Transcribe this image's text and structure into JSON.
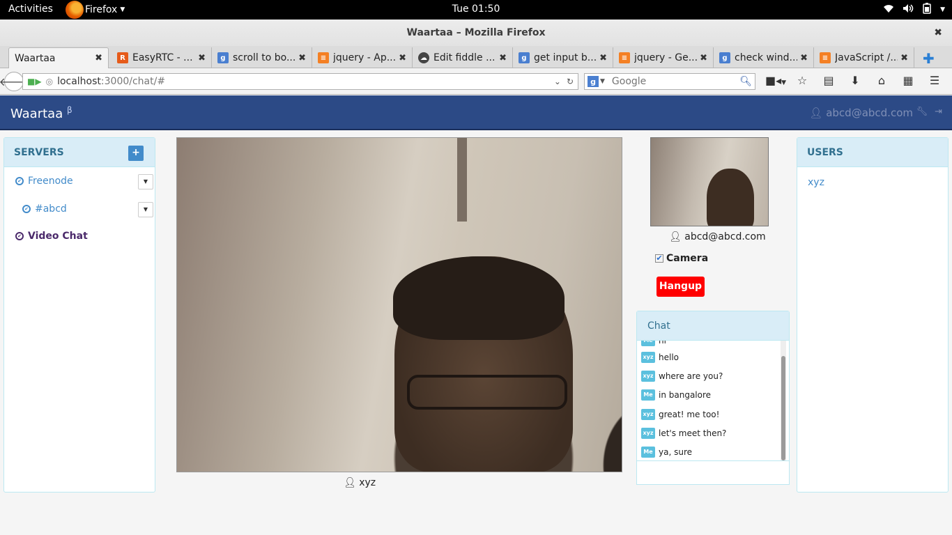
{
  "gnome": {
    "activities": "Activities",
    "app_name": "Firefox",
    "clock": "Tue 01:50"
  },
  "window": {
    "title": "Waartaa – Mozilla Firefox"
  },
  "tabs": [
    {
      "label": "Waartaa",
      "favicon": "none"
    },
    {
      "label": "EasyRTC - ...",
      "favicon": "easyrtc-icon"
    },
    {
      "label": "scroll to bo...",
      "favicon": "google-icon"
    },
    {
      "label": "jquery - Ap...",
      "favicon": "stackoverflow-icon"
    },
    {
      "label": "Edit fiddle ...",
      "favicon": "jsfiddle-icon"
    },
    {
      "label": "get input b...",
      "favicon": "google-icon"
    },
    {
      "label": "jquery - Ge...",
      "favicon": "stackoverflow-icon"
    },
    {
      "label": "check wind...",
      "favicon": "google-icon"
    },
    {
      "label": "JavaScript /...",
      "favicon": "stackoverflow-icon"
    }
  ],
  "navbar": {
    "url_host": "localhost",
    "url_path": ":3000/chat/#",
    "search_placeholder": "Google"
  },
  "app": {
    "brand": "Waartaa",
    "brand_sup": "β",
    "user_email": "abcd@abcd.com",
    "colors": {
      "header": "#2c4a86",
      "accent": "#428bca",
      "hangup": "#ff0000"
    }
  },
  "servers": {
    "heading": "SERVERS",
    "add_label": "+",
    "items": [
      {
        "label": "Freenode"
      },
      {
        "label": "#abcd"
      },
      {
        "label": "Video Chat"
      }
    ]
  },
  "video": {
    "remote_user": "xyz",
    "local_user": "abcd@abcd.com",
    "camera_label": "Camera",
    "camera_checked": true,
    "hangup_label": "Hangup"
  },
  "chat": {
    "heading": "Chat",
    "messages": [
      {
        "from": "Me",
        "text": "hi"
      },
      {
        "from": "xyz",
        "text": "hello"
      },
      {
        "from": "xyz",
        "text": "where are you?"
      },
      {
        "from": "Me",
        "text": "in bangalore"
      },
      {
        "from": "xyz",
        "text": "great! me too!"
      },
      {
        "from": "xyz",
        "text": "let's meet then?"
      },
      {
        "from": "Me",
        "text": "ya, sure"
      }
    ],
    "input_value": ""
  },
  "users": {
    "heading": "USERS",
    "items": [
      "xyz"
    ]
  }
}
